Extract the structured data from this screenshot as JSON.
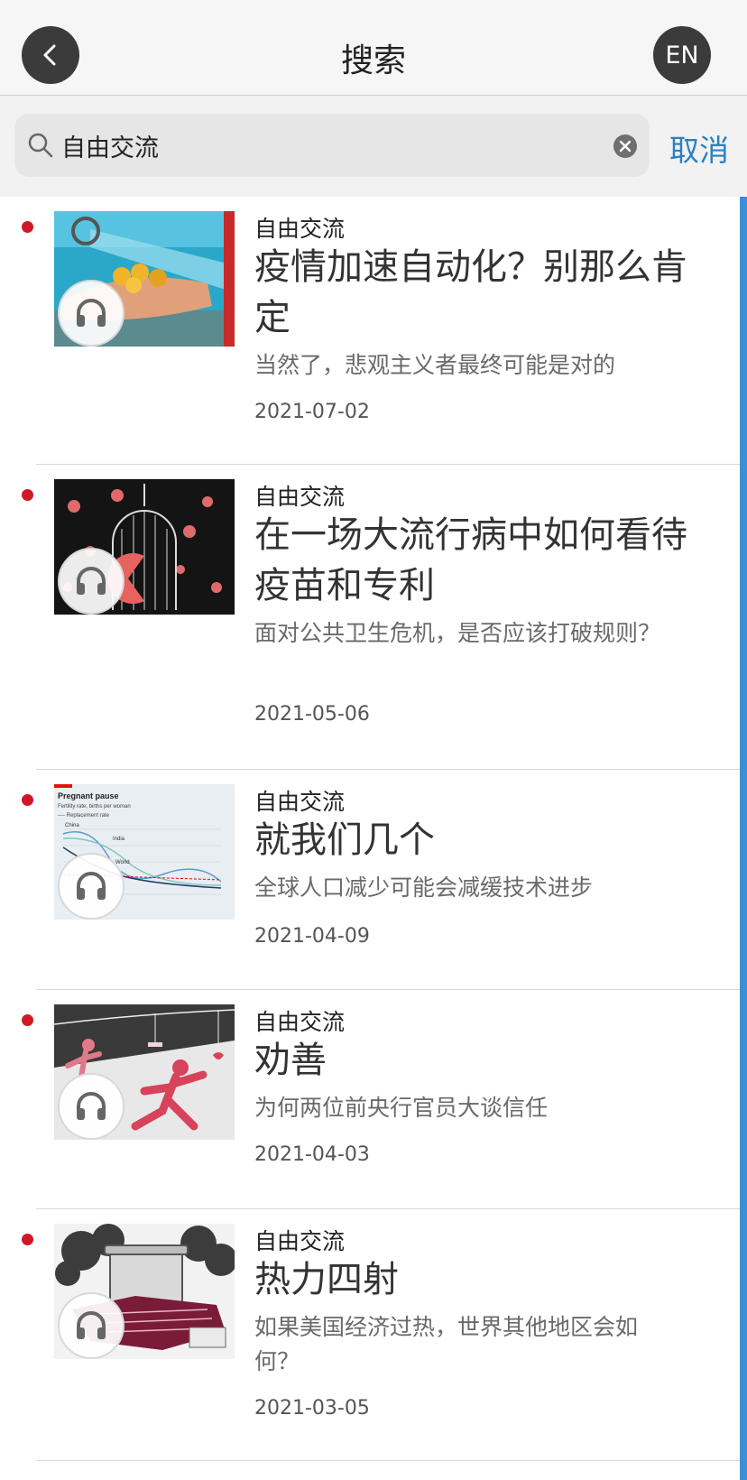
{
  "header": {
    "title": "搜索",
    "language_button": "EN",
    "back_icon": "chevron-left-icon"
  },
  "search": {
    "value": "自由交流",
    "cancel_label": "取消",
    "search_icon": "search-icon",
    "clear_icon": "clear-icon"
  },
  "colors": {
    "accent_blue": "#2880c4",
    "unread_dot": "#d11826",
    "header_button": "#3b3b3b",
    "scrollbar": "#3b8fd6"
  },
  "articles": [
    {
      "category": "自由交流",
      "title": "疫情加速自动化？别那么肯定",
      "summary": "当然了，悲观主义者最终可能是对的",
      "date": "2021-07-02",
      "unread": true,
      "has_audio": true
    },
    {
      "category": "自由交流",
      "title": "在一场大流行病中如何看待疫苗和专利",
      "summary": "面对公共卫生危机，是否应该打破规则？",
      "date": "2021-05-06",
      "unread": true,
      "has_audio": true
    },
    {
      "category": "自由交流",
      "title": "就我们几个",
      "summary": "全球人口减少可能会减缓技术进步",
      "date": "2021-04-09",
      "unread": true,
      "has_audio": true,
      "thumbnail_text": {
        "title": "Pregnant pause",
        "subtitle": "Fertility rate, births per woman",
        "legend": "---- Replacement rate",
        "labels": [
          "China",
          "India",
          "World"
        ]
      }
    },
    {
      "category": "自由交流",
      "title": "劝善",
      "summary": "为何两位前央行官员大谈信任",
      "date": "2021-04-03",
      "unread": true,
      "has_audio": true
    },
    {
      "category": "自由交流",
      "title": "热力四射",
      "summary": "如果美国经济过热，世界其他地区会如何？",
      "date": "2021-03-05",
      "unread": true,
      "has_audio": true
    }
  ]
}
